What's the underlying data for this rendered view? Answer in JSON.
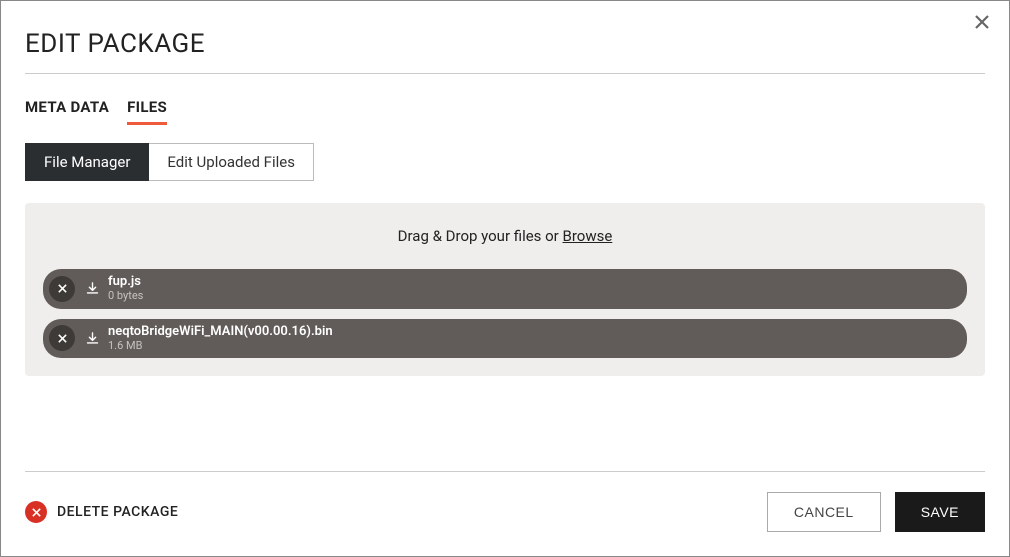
{
  "modal": {
    "title": "EDIT PACKAGE"
  },
  "tabs": {
    "meta_data": "META DATA",
    "files": "FILES"
  },
  "subtabs": {
    "file_manager": "File Manager",
    "edit_uploaded": "Edit Uploaded Files"
  },
  "dropzone": {
    "text": "Drag & Drop your files or ",
    "browse": "Browse"
  },
  "files": [
    {
      "name": "fup.js",
      "size": "0 bytes"
    },
    {
      "name": "neqtoBridgeWiFi_MAIN(v00.00.16).bin",
      "size": "1.6 MB"
    }
  ],
  "footer": {
    "delete": "DELETE PACKAGE",
    "cancel": "CANCEL",
    "save": "SAVE"
  }
}
